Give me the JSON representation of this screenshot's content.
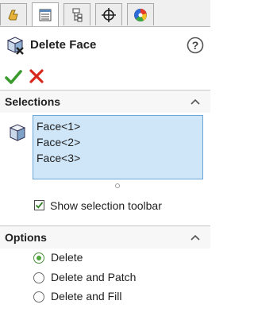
{
  "tabs": [
    {
      "name": "feature-manager-tab",
      "icon": "feature-manager-icon",
      "active": false
    },
    {
      "name": "property-manager-tab",
      "icon": "property-manager-icon",
      "active": true
    },
    {
      "name": "configuration-manager-tab",
      "icon": "configuration-manager-icon",
      "active": false
    },
    {
      "name": "dimxpert-manager-tab",
      "icon": "crosshair-icon",
      "active": false
    },
    {
      "name": "display-manager-tab",
      "icon": "color-wheel-icon",
      "active": false
    }
  ],
  "header": {
    "title": "Delete Face"
  },
  "selections": {
    "title": "Selections",
    "items": [
      "Face<1>",
      "Face<2>",
      "Face<3>"
    ],
    "show_toolbar_label": "Show selection toolbar",
    "show_toolbar_checked": true
  },
  "options": {
    "title": "Options",
    "choices": [
      {
        "label": "Delete",
        "selected": true
      },
      {
        "label": "Delete and Patch",
        "selected": false
      },
      {
        "label": "Delete and Fill",
        "selected": false
      }
    ]
  },
  "colors": {
    "ok": "#3a9a2e",
    "cancel": "#d8281c",
    "selection_bg": "#cfe6f8",
    "selection_border": "#6aa7d8"
  }
}
